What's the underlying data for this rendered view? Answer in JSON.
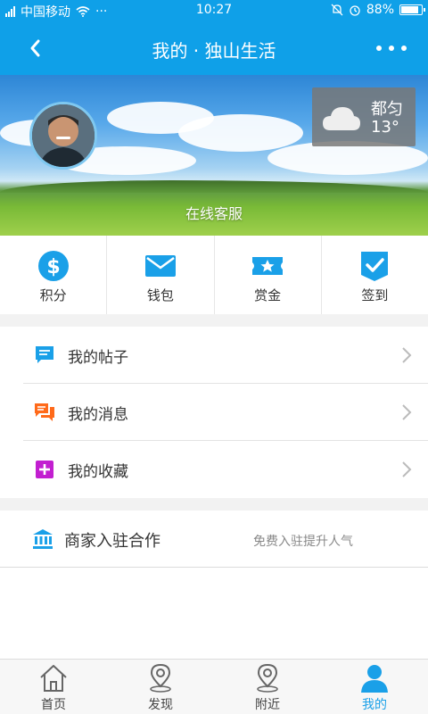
{
  "status_bar": {
    "carrier": "中国移动",
    "menu_dots": "···",
    "time": "10:27",
    "battery_percent": "88%",
    "battery_level": 0.88
  },
  "nav": {
    "title": "我的 · 独山生活",
    "back_icon": "chevron-left-icon",
    "more_icon": "more-dots-icon"
  },
  "banner": {
    "weather": {
      "city": "都匀",
      "temp": "13°",
      "icon": "cloud-icon"
    },
    "service_label": "在线客服"
  },
  "actions": [
    {
      "label": "积分",
      "icon": "dollar-circle-icon",
      "color": "#1aa0e8"
    },
    {
      "label": "钱包",
      "icon": "envelope-icon",
      "color": "#1aa0e8"
    },
    {
      "label": "赏金",
      "icon": "ticket-star-icon",
      "color": "#1aa0e8"
    },
    {
      "label": "签到",
      "icon": "check-shield-icon",
      "color": "#1aa0e8"
    }
  ],
  "menu": [
    {
      "label": "我的帖子",
      "icon": "post-icon",
      "color": "#1aa0e8"
    },
    {
      "label": "我的消息",
      "icon": "chat-icon",
      "color": "#ff6a1a"
    },
    {
      "label": "我的收藏",
      "icon": "favorite-plus-icon",
      "color": "#c21fd0"
    }
  ],
  "merchant": {
    "label": "商家入驻合作",
    "hint": "免费入驻提升人气",
    "icon": "bank-icon",
    "color": "#1aa0e8"
  },
  "tabs": [
    {
      "label": "首页",
      "icon": "home-icon",
      "active": false
    },
    {
      "label": "发现",
      "icon": "location-pin-icon",
      "active": false
    },
    {
      "label": "附近",
      "icon": "location-pin-icon",
      "active": false
    },
    {
      "label": "我的",
      "icon": "person-icon",
      "active": true
    }
  ],
  "colors": {
    "primary": "#0fa0e8",
    "accent": "#1aa0e8"
  }
}
